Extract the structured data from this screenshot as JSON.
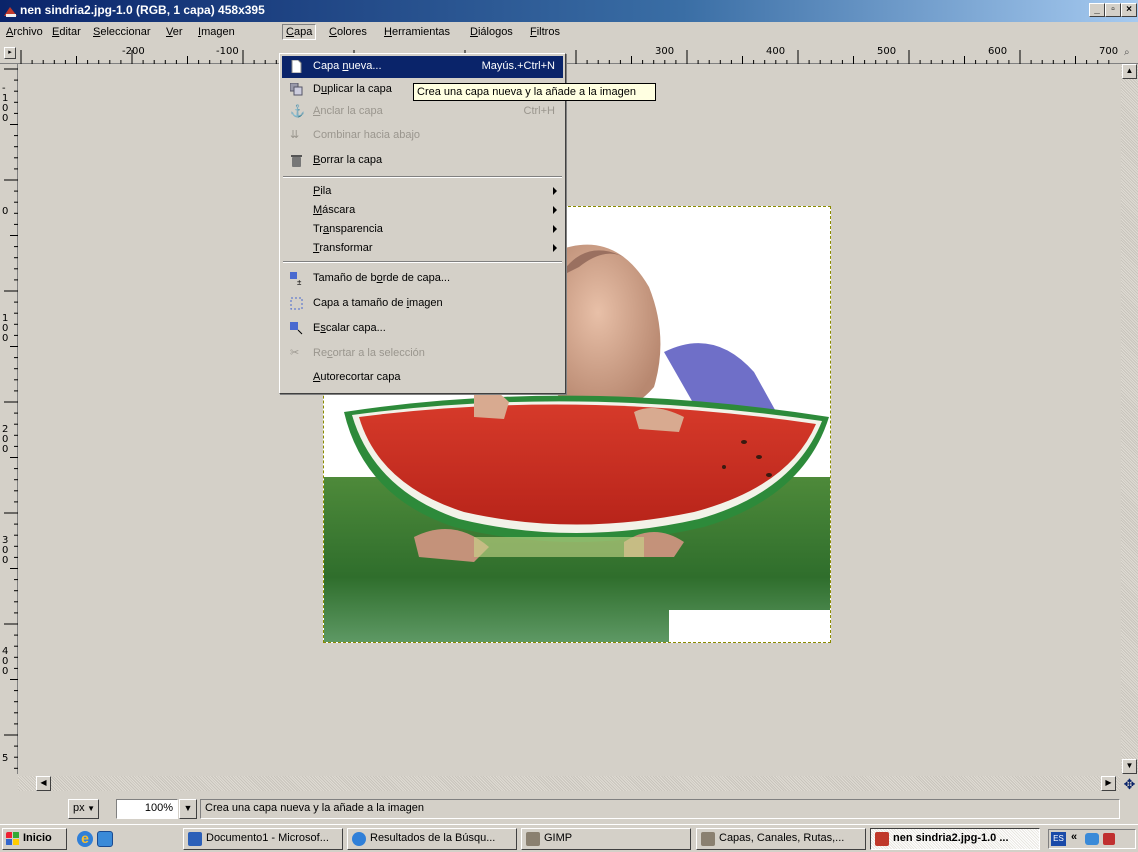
{
  "window": {
    "title": "nen sindria2.jpg-1.0 (RGB, 1 capa) 458x395",
    "controls": [
      "_",
      "▫",
      "×"
    ]
  },
  "menubar": {
    "items": [
      {
        "pre": "",
        "u": "A",
        "post": "rchivo"
      },
      {
        "pre": "",
        "u": "E",
        "post": "ditar"
      },
      {
        "pre": "",
        "u": "S",
        "post": "eleccionar"
      },
      {
        "pre": "",
        "u": "V",
        "post": "er"
      },
      {
        "pre": "",
        "u": "I",
        "post": "magen"
      },
      {
        "pre": "",
        "u": "C",
        "post": "apa"
      },
      {
        "pre": "",
        "u": "C",
        "post": "olores"
      },
      {
        "pre": "",
        "u": "H",
        "post": "erramientas"
      },
      {
        "pre": "",
        "u": "D",
        "post": "iálogos"
      },
      {
        "pre": "",
        "u": "F",
        "post": "iltros"
      }
    ]
  },
  "hruler": {
    "labels": [
      "-200",
      "-100",
      "300",
      "400",
      "500",
      "600",
      "700"
    ]
  },
  "vruler": {
    "labels": [
      "-100",
      "0",
      "100",
      "200",
      "300",
      "400",
      "5"
    ]
  },
  "capa_menu": {
    "items": [
      {
        "pre": "Capa ",
        "u": "n",
        "post": "ueva...",
        "shortcut": "Mayús.+Ctrl+N",
        "icon": "new-layer-icon"
      },
      {
        "pre": "D",
        "u": "u",
        "post": "plicar la capa",
        "shortcut": "",
        "icon": "duplicate-layer-icon"
      },
      {
        "pre": "",
        "u": "A",
        "post": "nclar la capa",
        "shortcut": "Ctrl+H",
        "icon": "anchor-icon"
      },
      {
        "pre": "Combinar hacia abajo",
        "u": "",
        "post": "",
        "shortcut": "",
        "icon": "merge-down-icon"
      },
      {
        "pre": "",
        "u": "B",
        "post": "orrar la capa",
        "shortcut": "",
        "icon": "trash-icon"
      },
      {
        "pre": "",
        "u": "P",
        "post": "ila",
        "shortcut": "",
        "icon": ""
      },
      {
        "pre": "",
        "u": "M",
        "post": "áscara",
        "shortcut": "",
        "icon": ""
      },
      {
        "pre": "Tr",
        "u": "a",
        "post": "nsparencia",
        "shortcut": "",
        "icon": ""
      },
      {
        "pre": "",
        "u": "T",
        "post": "ransformar",
        "shortcut": "",
        "icon": ""
      },
      {
        "pre": "Tamaño de b",
        "u": "o",
        "post": "rde de capa...",
        "shortcut": "",
        "icon": "layer-boundary-icon"
      },
      {
        "pre": "Capa a tamaño de ",
        "u": "i",
        "post": "magen",
        "shortcut": "",
        "icon": "layer-to-image-icon"
      },
      {
        "pre": "E",
        "u": "s",
        "post": "calar capa...",
        "shortcut": "",
        "icon": "scale-layer-icon"
      },
      {
        "pre": "Re",
        "u": "c",
        "post": "ortar a la selección",
        "shortcut": "",
        "icon": "crop-icon"
      },
      {
        "pre": "",
        "u": "A",
        "post": "utorecortar capa",
        "shortcut": "",
        "icon": ""
      }
    ]
  },
  "tooltip": "Crea una capa nueva y la añade a la imagen",
  "statusbar": {
    "unit": "px",
    "zoom": "100%",
    "message": "Crea una capa nueva y la añade a la imagen"
  },
  "taskbar": {
    "start": "Inicio",
    "buttons": [
      {
        "label": "Documento1 - Microsof...",
        "icon": "word-icon"
      },
      {
        "label": "Resultados de la Búsqu...",
        "icon": "ie-icon"
      },
      {
        "label": "GIMP",
        "icon": "gimp-icon"
      },
      {
        "label": "Capas, Canales, Rutas,...",
        "icon": "gimp-icon"
      },
      {
        "label": "nen sindria2.jpg-1.0 ...",
        "icon": "gimp-image-icon"
      }
    ],
    "tray_lang": "ES",
    "tray_chevron": "«"
  },
  "colors": {
    "selection": "#0a246a",
    "face": "#d4d0c8",
    "tooltip_bg": "#ffffe1"
  }
}
